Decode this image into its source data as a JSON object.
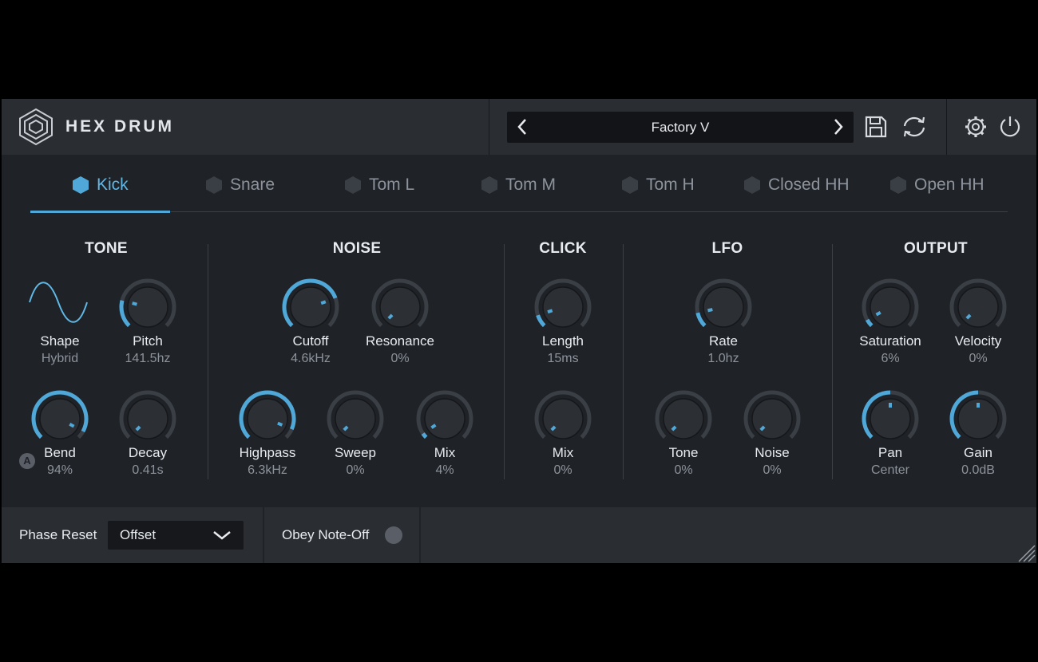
{
  "app": {
    "name": "HEX DRUM"
  },
  "header": {
    "preset_name": "Factory V",
    "icons": [
      "hexagon-logo-icon",
      "chevron-left-icon",
      "chevron-right-icon",
      "save-icon",
      "refresh-icon",
      "gear-icon",
      "power-icon"
    ]
  },
  "tabs": [
    {
      "label": "Kick",
      "active": true
    },
    {
      "label": "Snare",
      "active": false
    },
    {
      "label": "Tom L",
      "active": false
    },
    {
      "label": "Tom M",
      "active": false
    },
    {
      "label": "Tom H",
      "active": false
    },
    {
      "label": "Closed HH",
      "active": false
    },
    {
      "label": "Open HH",
      "active": false
    }
  ],
  "sections": {
    "tone": {
      "title": "TONE",
      "shape": {
        "label": "Shape",
        "value": "Hybrid"
      },
      "pitch": {
        "label": "Pitch",
        "value": "141.5hz",
        "level": 0.22
      },
      "bend": {
        "label": "Bend",
        "value": "94%",
        "level": 0.94,
        "automation_badge": "A"
      },
      "decay": {
        "label": "Decay",
        "value": "0.41s",
        "level": 0.0
      }
    },
    "noise": {
      "title": "NOISE",
      "cutoff": {
        "label": "Cutoff",
        "value": "4.6kHz",
        "level": 0.76
      },
      "resonance": {
        "label": "Resonance",
        "value": "0%",
        "level": 0.0
      },
      "highpass": {
        "label": "Highpass",
        "value": "6.3kHz",
        "level": 0.92
      },
      "sweep": {
        "label": "Sweep",
        "value": "0%",
        "level": 0.0
      },
      "mix": {
        "label": "Mix",
        "value": "4%",
        "level": 0.04
      }
    },
    "click": {
      "title": "CLICK",
      "length": {
        "label": "Length",
        "value": "15ms",
        "level": 0.1
      },
      "mix": {
        "label": "Mix",
        "value": "0%",
        "level": 0.0
      }
    },
    "lfo": {
      "title": "LFO",
      "rate": {
        "label": "Rate",
        "value": "1.0hz",
        "level": 0.12
      },
      "tone": {
        "label": "Tone",
        "value": "0%",
        "level": 0.0
      },
      "noise": {
        "label": "Noise",
        "value": "0%",
        "level": 0.0
      }
    },
    "output": {
      "title": "OUTPUT",
      "saturation": {
        "label": "Saturation",
        "value": "6%",
        "level": 0.06
      },
      "velocity": {
        "label": "Velocity",
        "value": "0%",
        "level": 0.0
      },
      "pan": {
        "label": "Pan",
        "value": "Center",
        "level": 0.5
      },
      "gain": {
        "label": "Gain",
        "value": "0.0dB",
        "level": 0.5
      }
    }
  },
  "footer": {
    "phase_reset_label": "Phase Reset",
    "phase_reset_value": "Offset",
    "obey_note_off_label": "Obey Note-Off",
    "obey_note_off": false
  },
  "colors": {
    "accent": "#4fa8d8",
    "panel": "#1f2226",
    "header": "#2a2d32",
    "knob_track": "#3a3e45",
    "knob_body": "#2c2f34"
  }
}
